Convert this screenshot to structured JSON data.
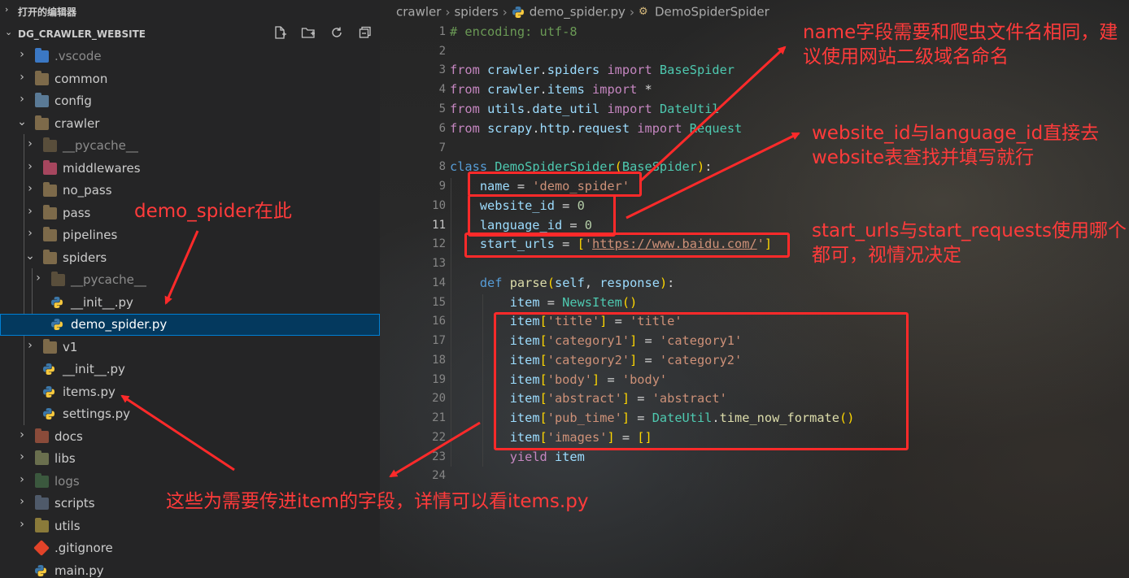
{
  "sidebar": {
    "open_editors_label": "打开的编辑器",
    "project_label": "DG_CRAWLER_WEBSITE",
    "toolbar_icons": [
      "new-file-icon",
      "new-folder-icon",
      "refresh-icon",
      "collapse-all-icon"
    ],
    "tree": [
      {
        "label": ".vscode",
        "kind": "folder",
        "icon": "vscode-folder-icon",
        "expanded": false
      },
      {
        "label": "common",
        "kind": "folder",
        "icon": "folder-icon",
        "expanded": false
      },
      {
        "label": "config",
        "kind": "folder",
        "icon": "config-folder-icon",
        "expanded": false
      },
      {
        "label": "crawler",
        "kind": "folder",
        "icon": "folder-open-icon",
        "expanded": true
      },
      {
        "label": "__pycache__",
        "kind": "folder",
        "icon": "folder-icon",
        "expanded": false
      },
      {
        "label": "middlewares",
        "kind": "folder",
        "icon": "middleware-folder-icon",
        "expanded": false
      },
      {
        "label": "no_pass",
        "kind": "folder",
        "icon": "folder-icon",
        "expanded": false
      },
      {
        "label": "pass",
        "kind": "folder",
        "icon": "folder-icon",
        "expanded": false
      },
      {
        "label": "pipelines",
        "kind": "folder",
        "icon": "folder-icon",
        "expanded": false
      },
      {
        "label": "spiders",
        "kind": "folder",
        "icon": "folder-open-icon",
        "expanded": true
      },
      {
        "label": "__pycache__",
        "kind": "folder",
        "icon": "folder-icon",
        "expanded": false
      },
      {
        "label": "__init__.py",
        "kind": "file",
        "icon": "python-file-icon"
      },
      {
        "label": "demo_spider.py",
        "kind": "file",
        "icon": "python-file-icon",
        "selected": true
      },
      {
        "label": "v1",
        "kind": "folder",
        "icon": "folder-icon",
        "expanded": false
      },
      {
        "label": "__init__.py",
        "kind": "file",
        "icon": "python-file-icon"
      },
      {
        "label": "items.py",
        "kind": "file",
        "icon": "python-file-icon"
      },
      {
        "label": "settings.py",
        "kind": "file",
        "icon": "python-file-icon"
      },
      {
        "label": "docs",
        "kind": "folder",
        "icon": "docs-folder-icon",
        "expanded": false
      },
      {
        "label": "libs",
        "kind": "folder",
        "icon": "libs-folder-icon",
        "expanded": false
      },
      {
        "label": "logs",
        "kind": "folder",
        "icon": "logs-folder-icon",
        "expanded": false,
        "dim": true
      },
      {
        "label": "scripts",
        "kind": "folder",
        "icon": "scripts-folder-icon",
        "expanded": false
      },
      {
        "label": "utils",
        "kind": "folder",
        "icon": "utils-folder-icon",
        "expanded": false
      },
      {
        "label": ".gitignore",
        "kind": "file",
        "icon": "git-file-icon"
      },
      {
        "label": "main.py",
        "kind": "file",
        "icon": "python-file-icon"
      }
    ]
  },
  "breadcrumb": {
    "parts": [
      "crawler",
      "spiders",
      "demo_spider.py",
      "DemoSpiderSpider"
    ]
  },
  "editor": {
    "line_numbers": [
      "1",
      "2",
      "3",
      "4",
      "5",
      "6",
      "7",
      "8",
      "9",
      "10",
      "11",
      "12",
      "13",
      "14",
      "15",
      "16",
      "17",
      "18",
      "19",
      "20",
      "21",
      "22",
      "23",
      "24"
    ],
    "active_line": "11",
    "lines": [
      "# encoding: utf-8",
      "",
      "from crawler.spiders import BaseSpider",
      "from crawler.items import *",
      "from utils.date_util import DateUtil",
      "from scrapy.http.request import Request",
      "",
      "class DemoSpiderSpider(BaseSpider):",
      "    name = 'demo_spider'",
      "    website_id = 0",
      "    language_id = 0",
      "    start_urls = ['https://www.baidu.com/']",
      "",
      "    def parse(self, response):",
      "        item = NewsItem()",
      "        item['title'] = 'title'",
      "        item['category1'] = 'category1'",
      "        item['category2'] = 'category2'",
      "        item['body'] = 'body'",
      "        item['abstract'] = 'abstract'",
      "        item['pub_time'] = DateUtil.time_now_formate()",
      "        item['images'] = []",
      "        yield item",
      ""
    ]
  },
  "annotations": {
    "name_note": "name字段需要和爬虫文件名相同，建议使用网站二级域名命名",
    "website_note": "website_id与language_id直接去website表查找并填写就行",
    "start_urls_note": "start_urls与start_requests使用哪个都可，视情况决定",
    "demo_spider_note": "demo_spider在此",
    "items_note": "这些为需要传进item的字段，详情可以看items.py",
    "color": "#ff2a2a"
  },
  "colors": {
    "sidebar_bg": "#252526",
    "selection_bg": "#04395e",
    "keyword": "#569cd6",
    "string": "#ce9178",
    "class": "#4ec9b0",
    "comment": "#6a9955"
  }
}
